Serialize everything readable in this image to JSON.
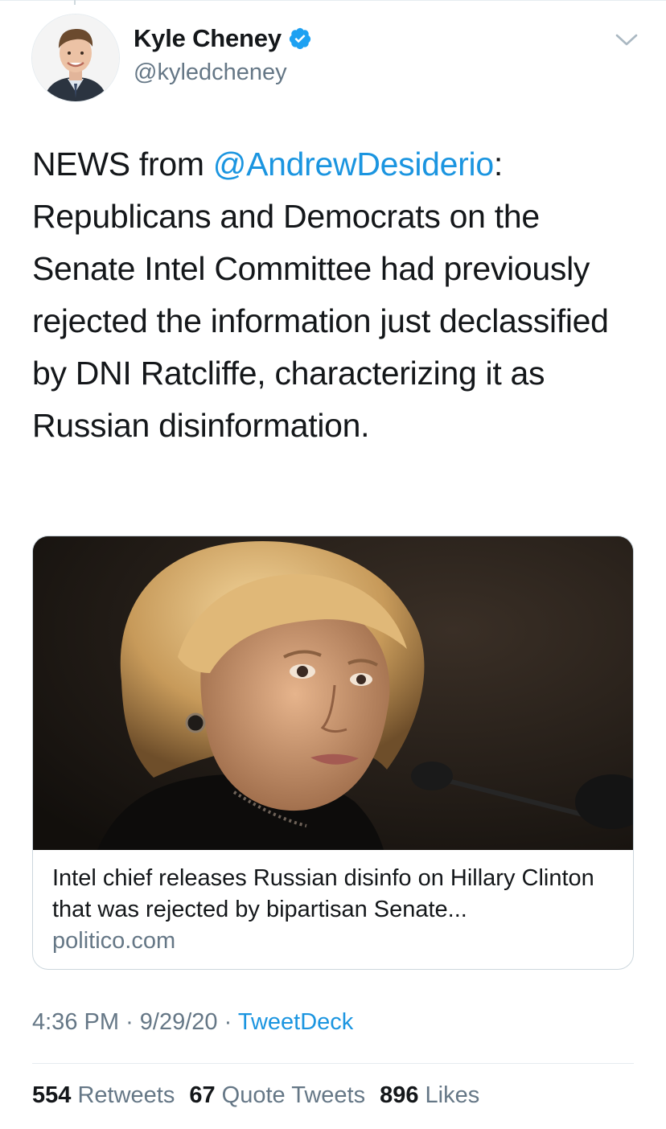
{
  "author": {
    "display_name": "Kyle Cheney",
    "handle": "@kyledcheney",
    "verified": true,
    "verified_icon": "verified-badge-icon",
    "menu_icon": "chevron-down-icon"
  },
  "tweet": {
    "prefix": "NEWS from ",
    "mention": "@AndrewDesiderio",
    "body": ": Republicans and Democrats on the Senate Intel Committee had previously rejected the information just declassified by DNI Ratcliffe, characterizing it as Russian disinformation."
  },
  "card": {
    "title": "Intel chief releases Russian disinfo on Hillary Clinton that was rejected by bipartisan Senate...",
    "domain": "politico.com"
  },
  "meta": {
    "time": "4:36 PM",
    "date": "9/29/20",
    "separator": "·",
    "source": "TweetDeck"
  },
  "stats": {
    "retweets_count": "554",
    "retweets_label": "Retweets",
    "quotes_count": "67",
    "quotes_label": "Quote Tweets",
    "likes_count": "896",
    "likes_label": "Likes"
  },
  "colors": {
    "link_blue": "#1b95e0",
    "secondary_gray": "#657786",
    "text_dark": "#14171a",
    "verified_blue": "#1da1f2"
  }
}
